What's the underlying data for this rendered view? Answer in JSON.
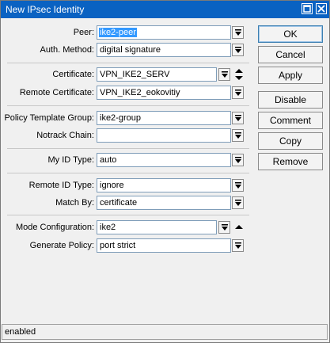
{
  "window": {
    "title": "New IPsec Identity"
  },
  "fields": {
    "peer": {
      "label": "Peer:",
      "value": "ike2-peer"
    },
    "auth_method": {
      "label": "Auth. Method:",
      "value": "digital signature"
    },
    "certificate": {
      "label": "Certificate:",
      "value": "VPN_IKE2_SERV"
    },
    "remote_certificate": {
      "label": "Remote Certificate:",
      "value": "VPN_IKE2_eokovitiy"
    },
    "policy_template_group": {
      "label": "Policy Template Group:",
      "value": "ike2-group"
    },
    "notrack_chain": {
      "label": "Notrack Chain:",
      "value": ""
    },
    "my_id_type": {
      "label": "My ID Type:",
      "value": "auto"
    },
    "remote_id_type": {
      "label": "Remote ID Type:",
      "value": "ignore"
    },
    "match_by": {
      "label": "Match By:",
      "value": "certificate"
    },
    "mode_configuration": {
      "label": "Mode Configuration:",
      "value": "ike2"
    },
    "generate_policy": {
      "label": "Generate Policy:",
      "value": "port strict"
    }
  },
  "buttons": {
    "ok": "OK",
    "cancel": "Cancel",
    "apply": "Apply",
    "disable": "Disable",
    "comment": "Comment",
    "copy": "Copy",
    "remove": "Remove"
  },
  "status": {
    "text": "enabled"
  },
  "colors": {
    "titlebar": "#0a62c2",
    "selection": "#3399ff",
    "dialog_bg": "#f0f0f0"
  },
  "icons": [
    "restore-icon",
    "close-icon",
    "dropdown-arrow-icon",
    "spin-updown-icon",
    "collapse-up-icon"
  ]
}
